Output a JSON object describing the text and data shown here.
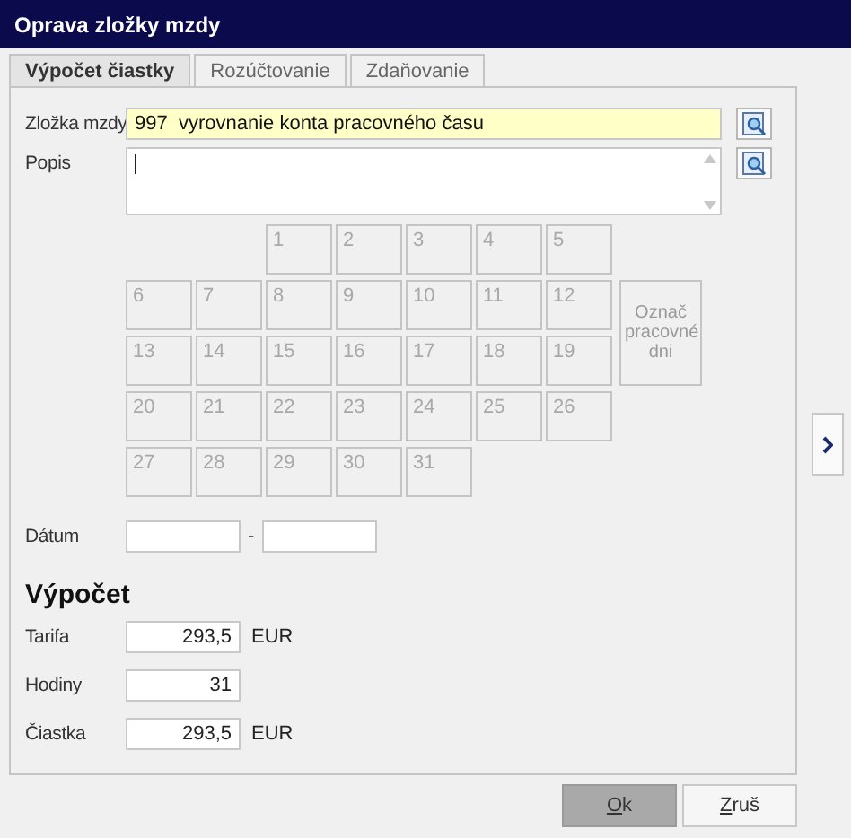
{
  "window": {
    "title": "Oprava zložky mzdy"
  },
  "tabs": [
    {
      "label": "Výpočet čiastky",
      "selected": true
    },
    {
      "label": "Rozúčtovanie",
      "selected": false
    },
    {
      "label": "Zdaňovanie",
      "selected": false
    }
  ],
  "wage_component": {
    "label": "Zložka mzdy",
    "value": "997  vyrovnanie konta pracovného času"
  },
  "description": {
    "label": "Popis"
  },
  "calendar": {
    "weeks": [
      [
        "1",
        "2",
        "3",
        "4",
        "5"
      ],
      [
        "6",
        "7",
        "8",
        "9",
        "10",
        "11",
        "12"
      ],
      [
        "13",
        "14",
        "15",
        "16",
        "17",
        "18",
        "19"
      ],
      [
        "20",
        "21",
        "22",
        "23",
        "24",
        "25",
        "26"
      ],
      [
        "27",
        "28",
        "29",
        "30",
        "31"
      ]
    ],
    "mark_button": "Označ pracovné dni"
  },
  "date": {
    "label": "Dátum",
    "separator": "-"
  },
  "calculation": {
    "heading": "Výpočet",
    "rows": [
      {
        "label": "Tarifa",
        "value": "293,5",
        "unit": "EUR"
      },
      {
        "label": "Hodiny",
        "value": "31"
      },
      {
        "label": "Čiastka",
        "value": "293,5",
        "unit": "EUR"
      }
    ]
  },
  "buttons": [
    {
      "label": "Ok",
      "kind": "primary"
    },
    {
      "label": "Zruš",
      "kind": "secondary"
    }
  ]
}
